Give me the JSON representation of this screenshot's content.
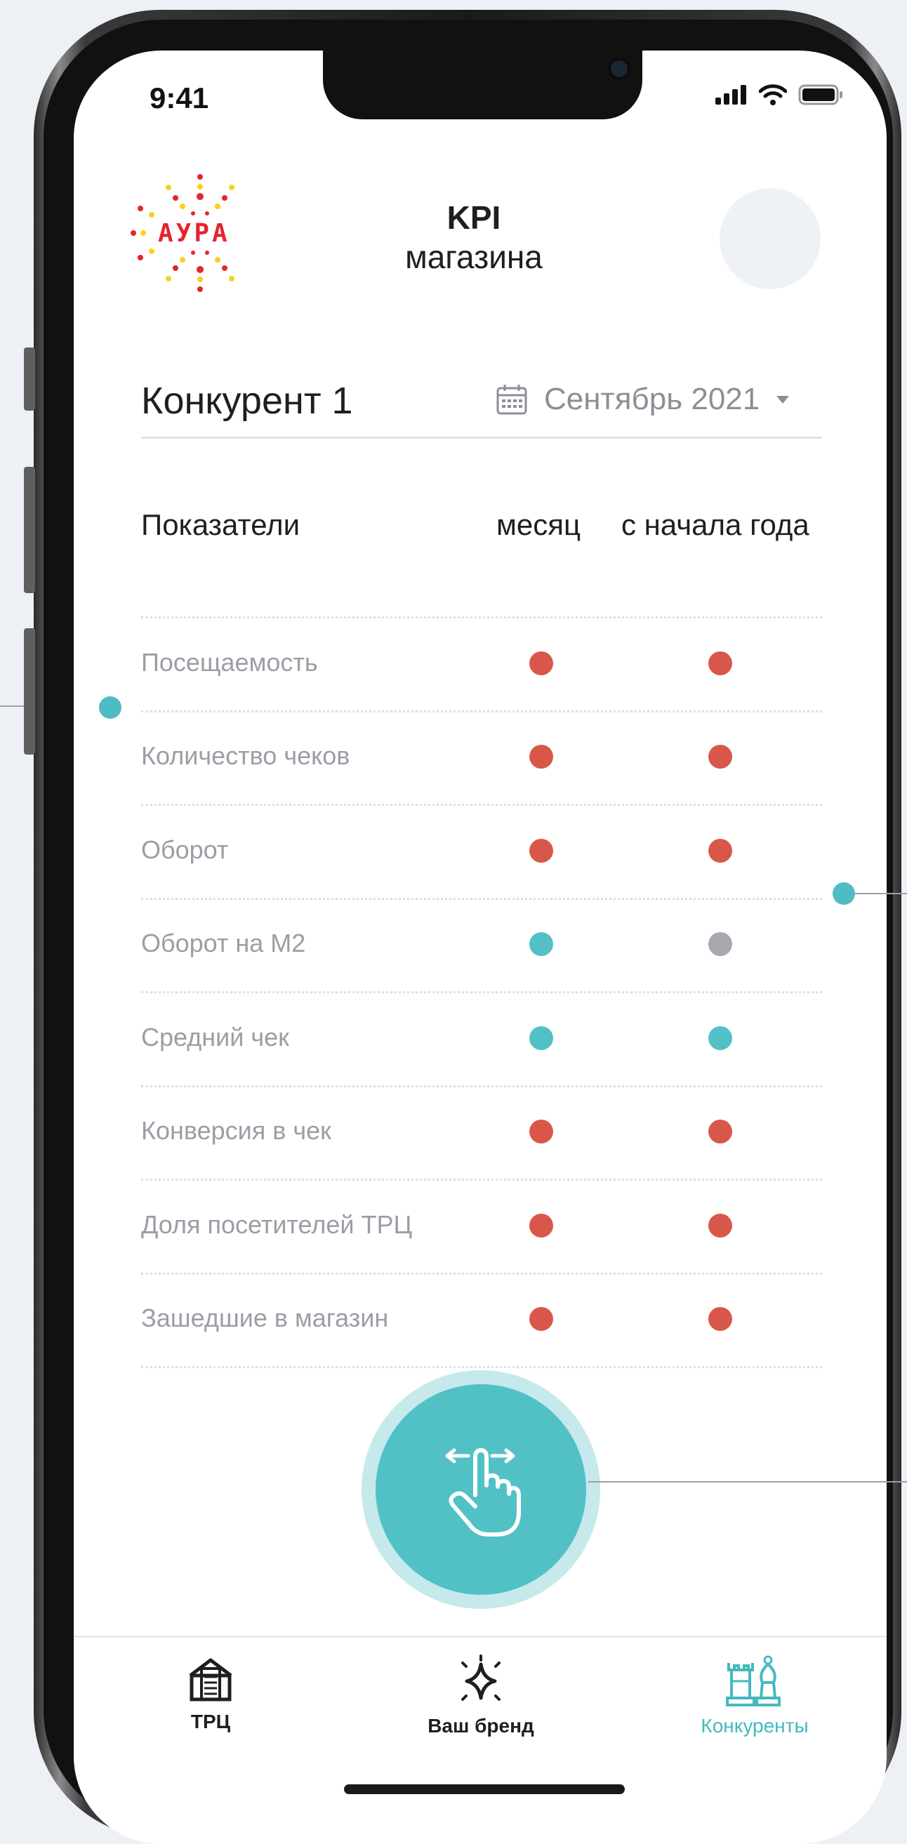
{
  "status_bar": {
    "time": "9:41"
  },
  "header": {
    "logo_text": "АУРА",
    "title_line1": "KPI",
    "title_line2": "магазина"
  },
  "selector": {
    "competitor": "Конкурент 1",
    "period": "Сентябрь 2021"
  },
  "table": {
    "headers": {
      "indicator": "Показатели",
      "month": "месяц",
      "ytd": "с начала года"
    },
    "rows": [
      {
        "label": "Посещаемость",
        "month": "red",
        "ytd": "red"
      },
      {
        "label": "Количество чеков",
        "month": "red",
        "ytd": "red"
      },
      {
        "label": "Оборот",
        "month": "red",
        "ytd": "red"
      },
      {
        "label": "Оборот на М2",
        "month": "teal",
        "ytd": "gray"
      },
      {
        "label": "Средний чек",
        "month": "teal",
        "ytd": "teal"
      },
      {
        "label": "Конверсия в чек",
        "month": "red",
        "ytd": "red"
      },
      {
        "label": "Доля посетителей ТРЦ",
        "month": "red",
        "ytd": "red"
      },
      {
        "label": "Зашедшие в магазин",
        "month": "red",
        "ytd": "red"
      }
    ]
  },
  "status_colors": {
    "red": "#d9574a",
    "teal": "#52c1c6",
    "gray": "#a6a9ad"
  },
  "swipe_button": {
    "icon": "swipe-hand-icon"
  },
  "tabbar": {
    "items": [
      {
        "label": "ТРЦ",
        "icon": "mall-building-icon",
        "active": false
      },
      {
        "label": "Ваш бренд",
        "icon": "sparkle-icon",
        "active": false
      },
      {
        "label": "Конкуренты",
        "icon": "chess-pieces-icon",
        "active": true
      }
    ]
  },
  "colors": {
    "accent": "#52c1c6",
    "background": "#edf1f6"
  }
}
